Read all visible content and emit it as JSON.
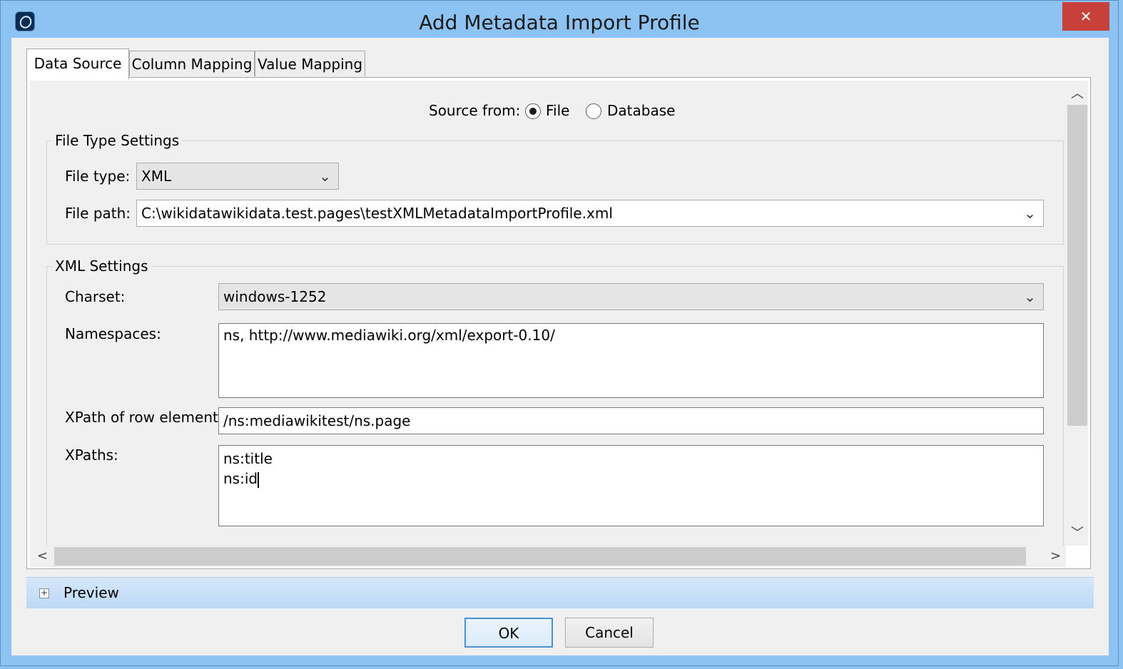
{
  "window": {
    "title": "Add Metadata Import Profile",
    "close_glyph": "✕"
  },
  "tabs": [
    {
      "label": "Data Source"
    },
    {
      "label": "Column Mapping"
    },
    {
      "label": "Value Mapping"
    }
  ],
  "source_from": {
    "label": "Source from:",
    "options": [
      "File",
      "Database"
    ],
    "selected": "File"
  },
  "file_type_settings": {
    "legend": "File Type Settings",
    "file_type_label": "File type:",
    "file_type_value": "XML",
    "file_path_label": "File path:",
    "file_path_value": "C:\\wikidatawikidata.test.pages\\testXMLMetadataImportProfile.xml"
  },
  "xml_settings": {
    "legend": "XML Settings",
    "charset_label": "Charset:",
    "charset_value": "windows-1252",
    "namespaces_label": "Namespaces:",
    "namespaces_value": "ns, http://www.mediawiki.org/xml/export-0.10/",
    "xpath_row_label": "XPath of row element",
    "xpath_row_value": "/ns:mediawikitest/ns.page",
    "xpaths_label": "XPaths:",
    "xpaths_lines": [
      "ns:title",
      "ns:id"
    ]
  },
  "preview": {
    "label": "Preview",
    "expand_glyph": "+"
  },
  "buttons": {
    "ok": "OK",
    "cancel": "Cancel"
  },
  "icons": {
    "scroll_up": "︿",
    "scroll_down": "﹀",
    "scroll_left": "<",
    "scroll_right": ">",
    "combo": "⌄"
  }
}
